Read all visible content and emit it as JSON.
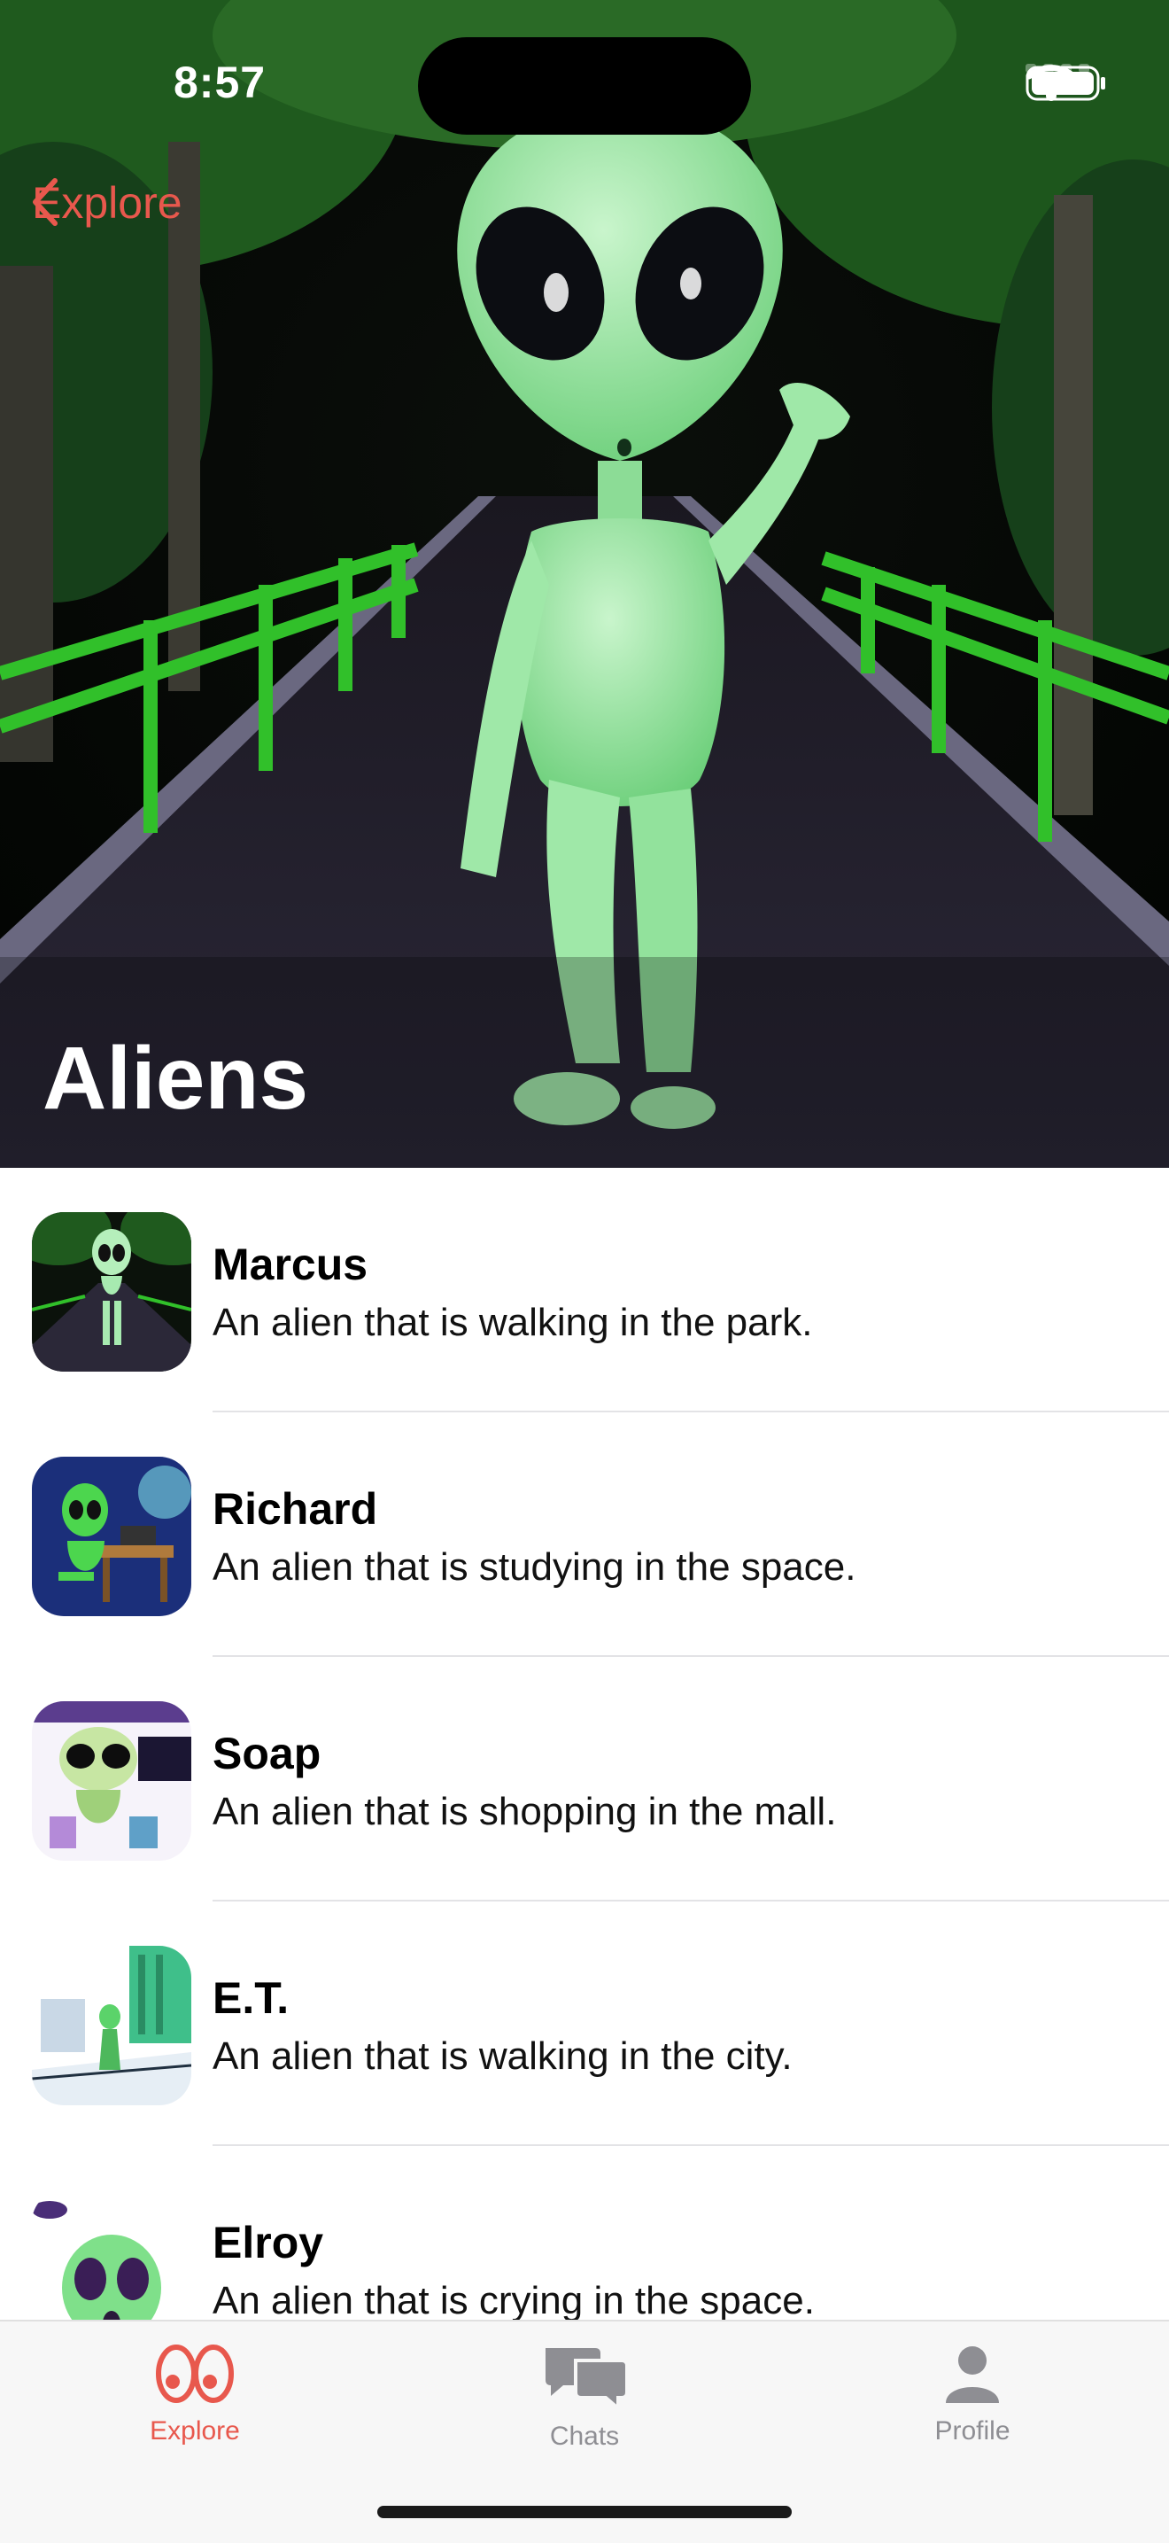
{
  "status_bar": {
    "time": "8:57"
  },
  "nav": {
    "back_label": "Explore"
  },
  "hero": {
    "title": "Aliens"
  },
  "characters": [
    {
      "name": "Marcus",
      "description": "An alien that is walking in the park."
    },
    {
      "name": "Richard",
      "description": "An alien that is studying in the space."
    },
    {
      "name": "Soap",
      "description": "An alien that is shopping in the mall."
    },
    {
      "name": "E.T.",
      "description": "An alien that is walking in the city."
    },
    {
      "name": "Elroy",
      "description": "An alien that is crying in the space."
    }
  ],
  "tabbar": {
    "tabs": [
      {
        "label": "Explore",
        "icon": "eyes-icon",
        "active": true
      },
      {
        "label": "Chats",
        "icon": "chat-bubbles-icon",
        "active": false
      },
      {
        "label": "Profile",
        "icon": "person-icon",
        "active": false
      }
    ]
  },
  "colors": {
    "accent": "#e8584d",
    "inactive": "#8e8e93",
    "alien_green": "#8ee39a"
  }
}
